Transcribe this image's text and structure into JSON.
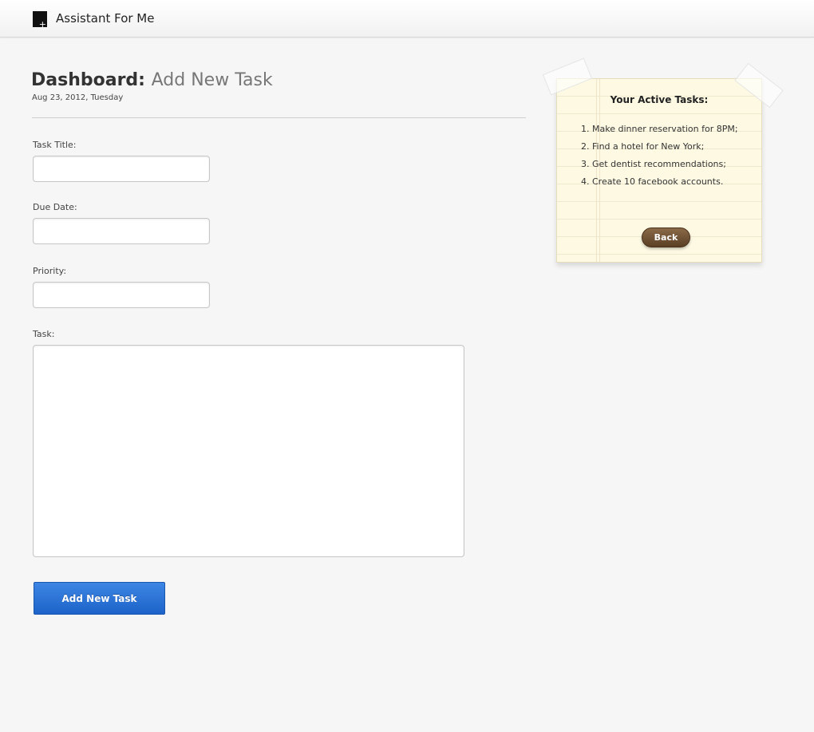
{
  "header": {
    "brand": "Assistant For Me",
    "logo_icon": "plus-box-icon"
  },
  "page": {
    "title_strong": "Dashboard:",
    "title_light": "Add New Task",
    "date": "Aug 23, 2012, Tuesday"
  },
  "form": {
    "task_title_label": "Task Title:",
    "task_title_value": "",
    "due_date_label": "Due Date:",
    "due_date_value": "",
    "priority_label": "Priority:",
    "priority_value": "",
    "task_label": "Task:",
    "task_value": "",
    "submit_label": "Add New Task",
    "submit_color": "#2a73d8"
  },
  "sidebar": {
    "title": "Your Active Tasks:",
    "tasks": [
      "1. Make dinner reservation for 8PM;",
      "2. Find a hotel for New York;",
      "3. Get dentist recommendations;",
      "4. Create 10 facebook accounts."
    ],
    "back_label": "Back",
    "note_color": "#fdf9e3",
    "back_color": "#6b4c2e"
  }
}
